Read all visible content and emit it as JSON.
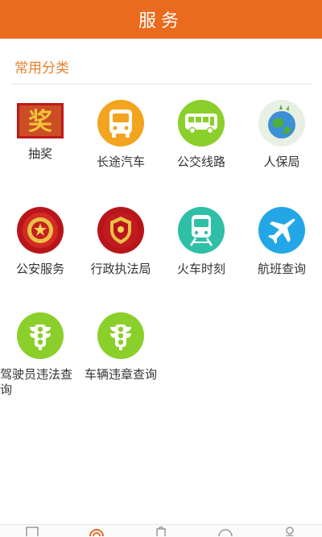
{
  "header": {
    "title": "服务"
  },
  "section": {
    "title": "常用分类"
  },
  "items": [
    {
      "label": "抽奖",
      "icon": "lottery-icon"
    },
    {
      "label": "长途汽车",
      "icon": "coach-bus-icon"
    },
    {
      "label": "公交线路",
      "icon": "city-bus-icon"
    },
    {
      "label": "人保局",
      "icon": "globe-icon"
    },
    {
      "label": "公安服务",
      "icon": "police-emblem-icon"
    },
    {
      "label": "行政执法局",
      "icon": "law-enforcement-emblem-icon"
    },
    {
      "label": "火车时刻",
      "icon": "train-icon"
    },
    {
      "label": "航班查询",
      "icon": "airplane-icon"
    },
    {
      "label": "驾驶员违法查询",
      "icon": "traffic-light-icon"
    },
    {
      "label": "车辆违章查询",
      "icon": "traffic-light-icon"
    }
  ],
  "tabbar": {
    "tabs": [
      {
        "icon": "news-icon"
      },
      {
        "icon": "service-icon",
        "active": true
      },
      {
        "icon": "bag-icon"
      },
      {
        "icon": "face-icon"
      },
      {
        "icon": "person-icon"
      }
    ]
  },
  "colors": {
    "header": "#ea6a1e",
    "section_title": "#e9822f",
    "tab_active": "#ea6a1e"
  }
}
